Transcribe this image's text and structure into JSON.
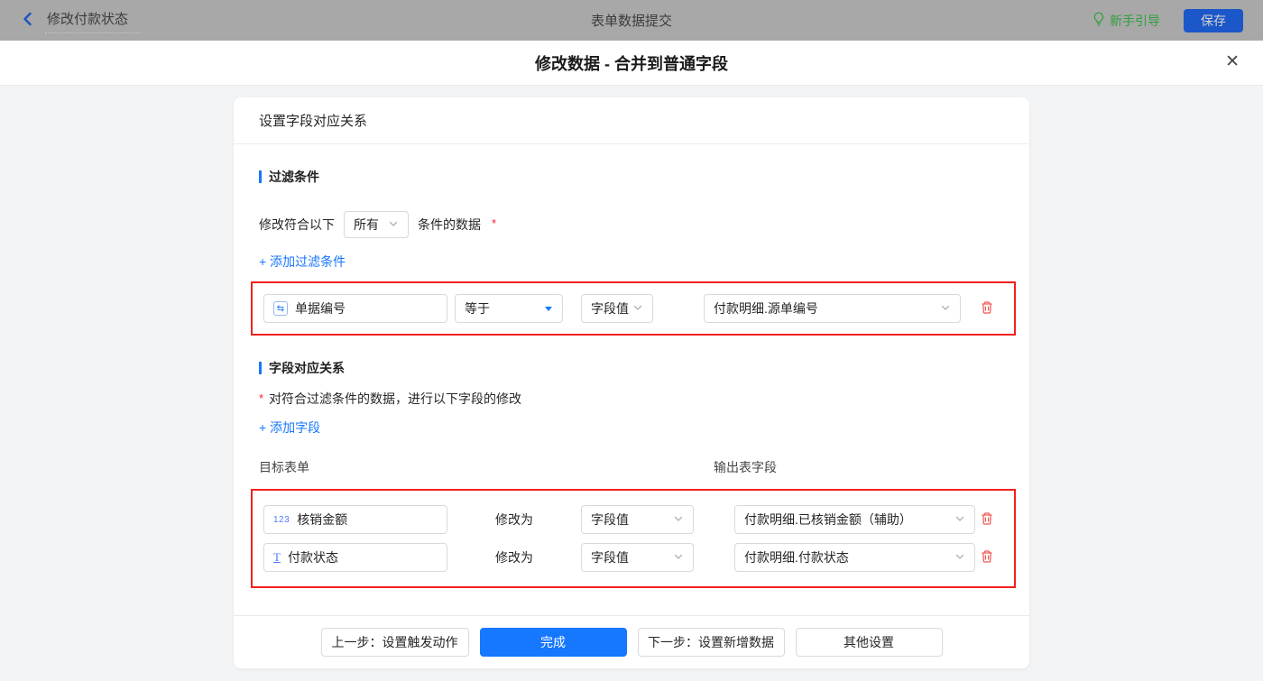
{
  "topbar": {
    "back_title": "修改付款状态",
    "center_title": "表单数据提交",
    "guide_label": "新手引导",
    "save_label": "保存"
  },
  "dialog": {
    "title": "修改数据 - 合并到普通字段",
    "close_glyph": "✕"
  },
  "card": {
    "header": "设置字段对应关系",
    "filter_section": {
      "title": "过滤条件",
      "match_prefix": "修改符合以下",
      "match_select": "所有",
      "match_suffix": "条件的数据",
      "required_mark": "*",
      "add_link": "+ 添加过滤条件",
      "condition": {
        "field_icon_glyph": "⇆",
        "field": "单据编号",
        "operator": "等于",
        "value_type": "字段值",
        "value": "付款明细.源单编号"
      }
    },
    "mapping_section": {
      "title": "字段对应关系",
      "required_mark": "*",
      "description": "对符合过滤条件的数据，进行以下字段的修改",
      "add_link": "+ 添加字段",
      "col_target": "目标表单",
      "col_output": "输出表字段",
      "rows": [
        {
          "field_icon_glyph": "123",
          "field": "核销金额",
          "action": "修改为",
          "value_type": "字段值",
          "value": "付款明细.已核销金额（辅助）"
        },
        {
          "field_icon_glyph": "T",
          "field": "付款状态",
          "action": "修改为",
          "value_type": "字段值",
          "value": "付款明细.付款状态"
        }
      ]
    }
  },
  "footer": {
    "prev_label": "上一步：设置触发动作",
    "done_label": "完成",
    "next_label": "下一步：设置新增数据",
    "other_label": "其他设置"
  },
  "colors": {
    "primary_blue": "#1677ff",
    "alert_red_border": "#f1211d",
    "trash_red": "#f0544f",
    "guide_green": "#2f9e3e",
    "topbar_dim_gray": "#a8a8a8"
  }
}
